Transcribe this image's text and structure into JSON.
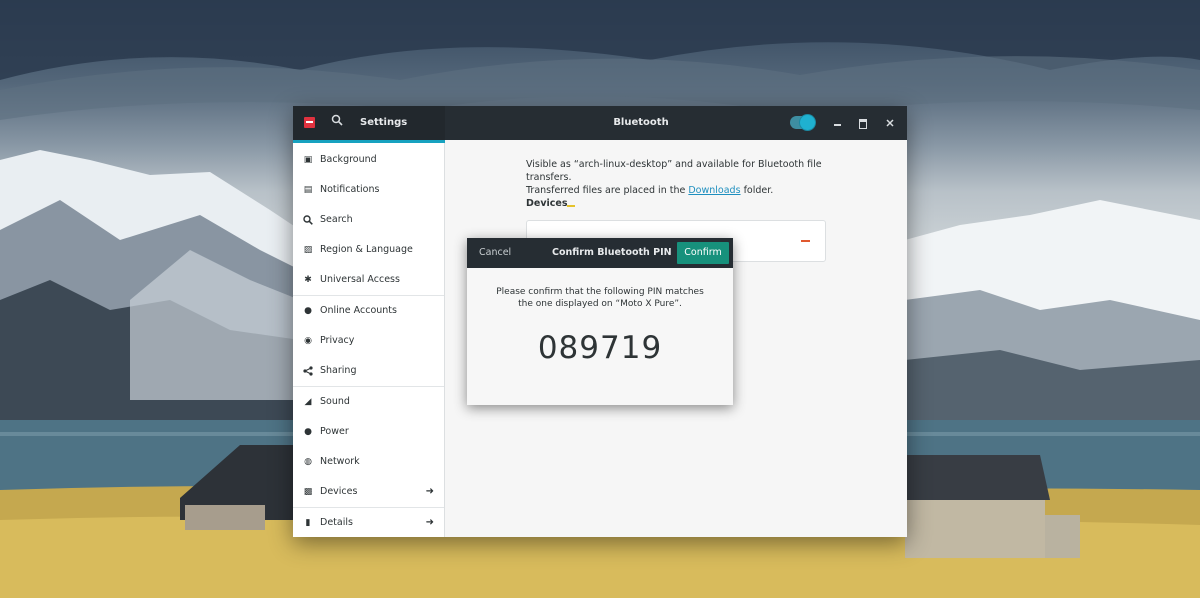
{
  "header": {
    "settings_title": "Settings",
    "panel_title": "Bluetooth",
    "bluetooth_enabled": true
  },
  "sidebar": {
    "items": [
      {
        "label": "Background",
        "icon": "background-icon"
      },
      {
        "label": "Notifications",
        "icon": "notifications-icon"
      },
      {
        "label": "Search",
        "icon": "search-icon"
      },
      {
        "label": "Region & Language",
        "icon": "region-icon"
      },
      {
        "label": "Universal Access",
        "icon": "universal-access-icon"
      },
      {
        "label": "Online Accounts",
        "icon": "online-accounts-icon"
      },
      {
        "label": "Privacy",
        "icon": "privacy-icon"
      },
      {
        "label": "Sharing",
        "icon": "sharing-icon"
      },
      {
        "label": "Sound",
        "icon": "sound-icon"
      },
      {
        "label": "Power",
        "icon": "power-icon"
      },
      {
        "label": "Network",
        "icon": "network-icon"
      },
      {
        "label": "Devices",
        "icon": "devices-icon",
        "arrow": true
      },
      {
        "label": "Details",
        "icon": "details-icon",
        "arrow": true
      }
    ]
  },
  "bluetooth": {
    "visible_text_1": "Visible as “arch-linux-desktop” and available for Bluetooth file transfers.",
    "visible_text_2": "Transferred files are placed in the",
    "downloads_link": "Downloads",
    "visible_text_3": "folder.",
    "devices_heading": "Devices"
  },
  "dialog": {
    "cancel_label": "Cancel",
    "title": "Confirm Bluetooth PIN",
    "confirm_label": "Confirm",
    "message_line1": "Please confirm that the following PIN matches",
    "message_line2": "the one displayed on “Moto X Pure”.",
    "pin": "089719"
  },
  "colors": {
    "headerbar": "#262d33",
    "accent": "#17a2c0",
    "confirm_button": "#17917c",
    "link": "#1e8fbf"
  }
}
